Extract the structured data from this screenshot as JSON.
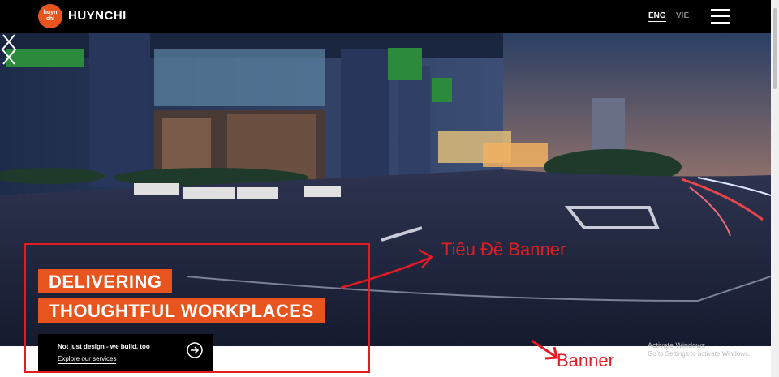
{
  "header": {
    "logo_badge_top": "huyn",
    "logo_badge_bottom": "chi",
    "logo_text": "HUYNCHI",
    "lang_eng": "ENG",
    "lang_vie": "VIE"
  },
  "hero": {
    "title_line_1": "DELIVERING",
    "title_line_2": "THOUGHTFUL WORKPLACES",
    "cta_line_1": "Not just design - we build, too",
    "cta_line_2": "Explore our services"
  },
  "annotations": {
    "banner_title_label": "Tiêu Đề Banner",
    "banner_label": "Banner"
  },
  "watermark": {
    "line_1": "Activate Windows",
    "line_2": "Go to Settings to activate Windows."
  },
  "colors": {
    "accent": "#e8541e",
    "annotation": "#e31b23"
  }
}
